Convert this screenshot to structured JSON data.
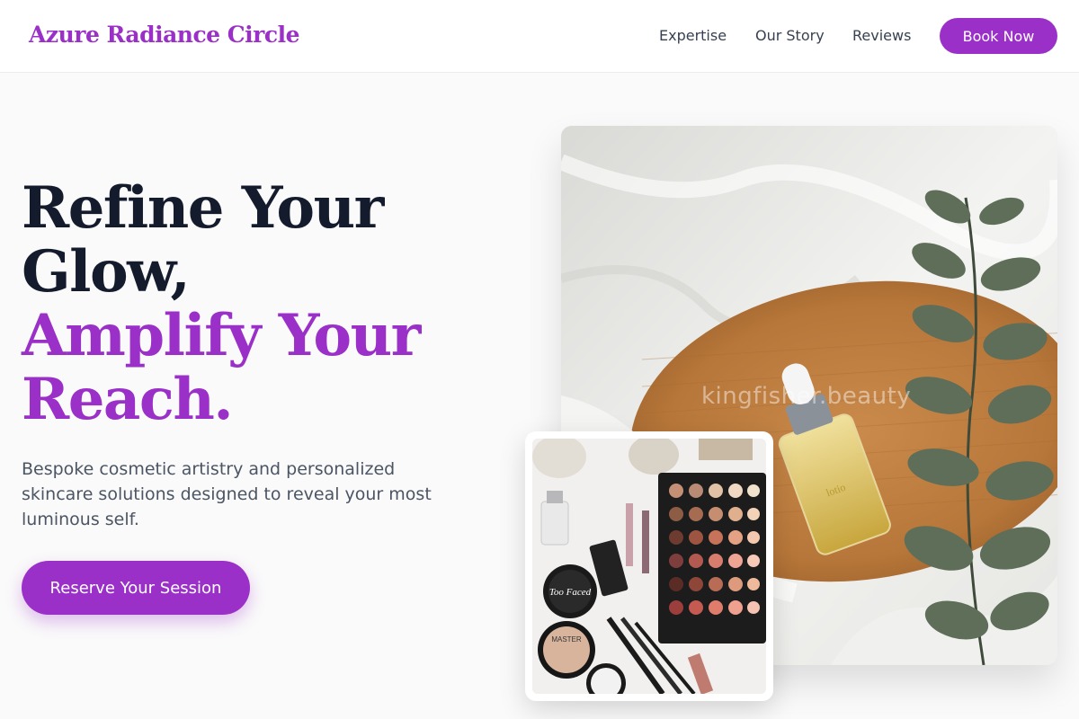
{
  "header": {
    "logo": "Azure Radiance Circle",
    "nav": [
      "Expertise",
      "Our Story",
      "Reviews"
    ],
    "book_label": "Book Now"
  },
  "hero": {
    "line1": "Refine Your",
    "line2": "Glow,",
    "line3": "Amplify Your",
    "line4": "Reach.",
    "description": "Bespoke cosmetic artistry and personalized skincare solutions designed to reveal your most luminous self.",
    "cta_label": "Reserve Your Session"
  },
  "images": {
    "main_watermark": "kingfisher.beauty",
    "main_icon": "serum-bottle-photo",
    "secondary_icon": "makeup-flatlay-photo"
  },
  "colors": {
    "accent": "#9b30c9",
    "heading": "#141b2d",
    "body_text": "#4b5563",
    "background": "#fafafa"
  }
}
